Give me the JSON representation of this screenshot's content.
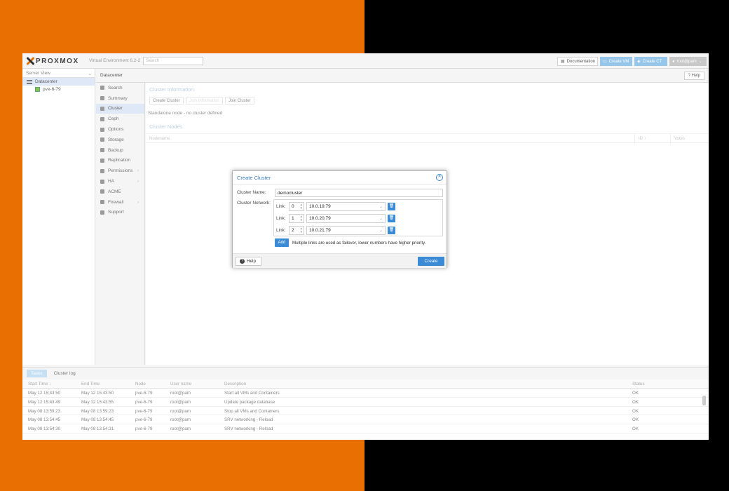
{
  "header": {
    "logo_text": "PROXMOX",
    "version": "Virtual Environment 6.2-2",
    "search_placeholder": "Search",
    "documentation": "Documentation",
    "create_vm": "Create VM",
    "create_ct": "Create CT",
    "user": "root@pam"
  },
  "tree": {
    "view": "Server View",
    "items": [
      {
        "label": "Datacenter"
      },
      {
        "label": "pve-6-79"
      }
    ]
  },
  "crumb": {
    "title": "Datacenter",
    "help": "Help"
  },
  "menu": {
    "items": [
      {
        "label": "Search"
      },
      {
        "label": "Summary"
      },
      {
        "label": "Cluster"
      },
      {
        "label": "Ceph"
      },
      {
        "label": "Options"
      },
      {
        "label": "Storage"
      },
      {
        "label": "Backup"
      },
      {
        "label": "Replication"
      },
      {
        "label": "Permissions"
      },
      {
        "label": "HA"
      },
      {
        "label": "ACME"
      },
      {
        "label": "Firewall"
      },
      {
        "label": "Support"
      }
    ]
  },
  "cluster": {
    "info_title": "Cluster Information",
    "create_btn": "Create Cluster",
    "join_info_btn": "Join Information",
    "join_btn": "Join Cluster",
    "standalone": "Standalone node - no cluster defined",
    "nodes_title": "Cluster Nodes",
    "col_nodename": "Nodename",
    "col_id": "ID ↑",
    "col_votes": "Votes"
  },
  "modal": {
    "title": "Create Cluster",
    "name_label": "Cluster Name:",
    "name_value": "democluster",
    "network_label": "Cluster Network:",
    "links": [
      {
        "label": "Link:",
        "num": "0",
        "ip": "10.0.19.79"
      },
      {
        "label": "Link:",
        "num": "1",
        "ip": "10.0.20.79"
      },
      {
        "label": "Link:",
        "num": "2",
        "ip": "10.0.21.79"
      }
    ],
    "add": "Add",
    "hint": "Multiple links are used as failover, lower numbers have higher priority.",
    "help": "Help",
    "create": "Create"
  },
  "tasks": {
    "tabs": [
      "Tasks",
      "Cluster log"
    ],
    "columns": [
      "Start Time ↓",
      "End Time",
      "Node",
      "User name",
      "Description",
      "Status"
    ],
    "rows": [
      [
        "May 12 15:43:50",
        "May 12 15:43:50",
        "pve-6-79",
        "root@pam",
        "Start all VMs and Containers",
        "OK"
      ],
      [
        "May 12 15:43:49",
        "May 12 15:43:55",
        "pve-6-79",
        "root@pam",
        "Update package database",
        "OK"
      ],
      [
        "May 08 13:59:23",
        "May 08 13:59:23",
        "pve-6-79",
        "root@pam",
        "Stop all VMs and Containers",
        "OK"
      ],
      [
        "May 08 13:54:45",
        "May 08 13:54:45",
        "pve-6-79",
        "root@pam",
        "SRV networking - Reload",
        "OK"
      ],
      [
        "May 08 13:54:30",
        "May 08 13:54:31",
        "pve-6-79",
        "root@pam",
        "SRV networking - Reload",
        "OK"
      ]
    ]
  }
}
